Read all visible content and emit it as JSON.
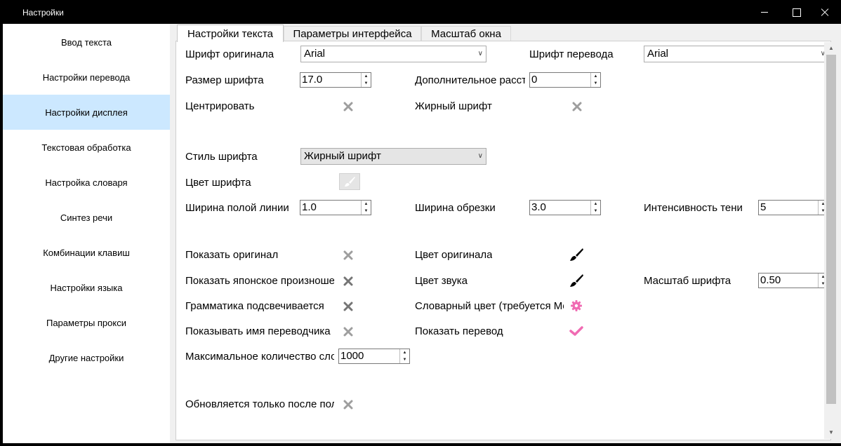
{
  "window": {
    "title": "Настройки"
  },
  "sidebar": {
    "items": [
      {
        "label": "Ввод текста"
      },
      {
        "label": "Настройки перевода"
      },
      {
        "label": "Настройки дисплея"
      },
      {
        "label": "Текстовая обработка"
      },
      {
        "label": "Настройка словаря"
      },
      {
        "label": "Синтез речи"
      },
      {
        "label": "Комбинации клавиш"
      },
      {
        "label": "Настройки языка"
      },
      {
        "label": "Параметры прокси"
      },
      {
        "label": "Другие настройки"
      }
    ],
    "active_label": "Настройки дисплея"
  },
  "tabs": [
    {
      "label": "Настройки текста"
    },
    {
      "label": "Параметры интерфейса"
    },
    {
      "label": "Масштаб окна"
    }
  ],
  "form": {
    "orig_font_label": "Шрифт оригинала",
    "orig_font_value": "Arial",
    "trans_font_label": "Шрифт перевода",
    "trans_font_value": "Arial",
    "font_size_label": "Размер шрифта",
    "font_size_value": "17.0",
    "extra_spacing_label": "Дополнительное расстояние",
    "extra_spacing_value": "0",
    "center_label": "Центрировать",
    "bold_label": "Жирный шрифт",
    "font_style_label": "Стиль шрифта",
    "font_style_value": "Жирный шрифт",
    "font_color_label": "Цвет шрифта",
    "hollow_line_label": "Ширина полой линии",
    "hollow_line_value": "1.0",
    "trim_width_label": "Ширина обрезки",
    "trim_width_value": "3.0",
    "shadow_label": "Интенсивность тени",
    "shadow_value": "5",
    "show_original_label": "Показать оригинал",
    "original_color_label": "Цвет оригинала",
    "show_japanese_label": "Показать японское произношение",
    "sound_color_label": "Цвет звука",
    "font_scale_label": "Масштаб шрифта",
    "font_scale_value": "0.50",
    "grammar_label": "Грамматика подсвечивается",
    "dict_color_label": "Словарный цвет (требуется MeCab)",
    "show_translator_label": "Показывать имя переводчика",
    "show_translation_label": "Показать перевод",
    "max_words_label": "Максимальное количество слов",
    "max_words_value": "1000",
    "update_after_label": "Обновляется только после получения"
  },
  "colors": {
    "accent_pink": "#f06bb3",
    "selected_bg": "#cce8ff",
    "toggle_off": "#9e9e9e"
  }
}
